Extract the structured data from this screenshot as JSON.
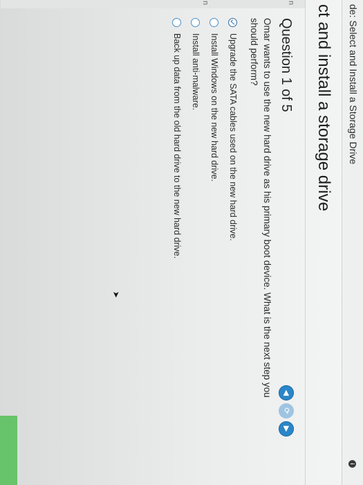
{
  "topbar": {
    "breadcrumb": "de: Select and Install a Storage Drive",
    "info_icon": "info-icon"
  },
  "header": {
    "title": "ct and install a storage drive"
  },
  "sidebar": {
    "fragments": [
      "n",
      "n"
    ]
  },
  "question": {
    "number_label": "Question 1 of 5",
    "text": "Omar wants to use the new hard drive as his primary boot device. What is the next step you should perform?",
    "options": [
      {
        "label": "Upgrade the SATA cables used on the new hard drive.",
        "selected": true
      },
      {
        "label": "Install Windows on the new hard drive.",
        "selected": false
      },
      {
        "label": "Install anti-malware.",
        "selected": false
      },
      {
        "label": "Back up data from the old hard drive to the new hard drive.",
        "selected": false
      }
    ]
  },
  "navigation": {
    "previous_icon": "triangle-up-icon",
    "refresh_icon": "refresh-icon",
    "next_icon": "triangle-down-icon"
  },
  "colors": {
    "accent": "#2a86c8",
    "status_band": "#68c46a"
  }
}
